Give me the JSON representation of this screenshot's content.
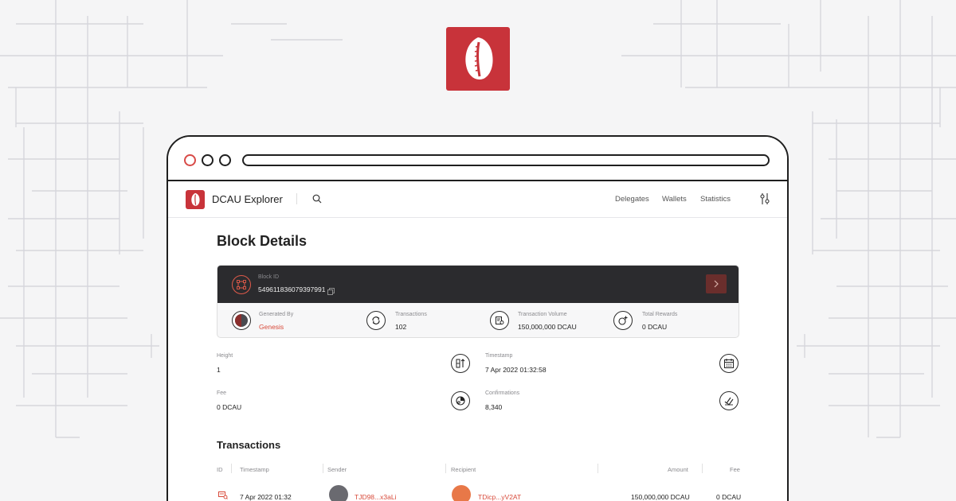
{
  "app": {
    "title": "DCAU Explorer",
    "nav": [
      "Delegates",
      "Wallets",
      "Statistics"
    ]
  },
  "page": {
    "title": "Block Details"
  },
  "block": {
    "id_label": "Block ID",
    "id_value": "5496118360793979​91",
    "stats": [
      {
        "label": "Generated By",
        "value": "Genesis",
        "icon": "delegate-avatar-icon"
      },
      {
        "label": "Transactions",
        "value": "102",
        "icon": "transfer-icon"
      },
      {
        "label": "Transaction Volume",
        "value": "150,000,000 DCAU",
        "icon": "volume-icon"
      },
      {
        "label": "Total Rewards",
        "value": "0 DCAU",
        "icon": "rewards-icon"
      }
    ]
  },
  "details": {
    "height": {
      "label": "Height",
      "value": "1"
    },
    "timestamp": {
      "label": "Timestamp",
      "value": "7 Apr 2022 01:32:58"
    },
    "fee": {
      "label": "Fee",
      "value": "0 DCAU"
    },
    "confirmations": {
      "label": "Confirmations",
      "value": "8,340"
    }
  },
  "transactions": {
    "title": "Transactions",
    "columns": [
      "ID",
      "Timestamp",
      "Sender",
      "Recipient",
      "Amount",
      "Fee"
    ],
    "rows": [
      {
        "timestamp": "7 Apr 2022 01:32",
        "sender": "TJD98...x3aLi",
        "recipient": "TDicp...yV2AT",
        "amount": "150,000,000 DCAU",
        "fee": "0 DCAU"
      }
    ]
  },
  "colors": {
    "brand": "#c8333a",
    "link": "#d84a3a",
    "dark_header": "#2b2b2e"
  }
}
